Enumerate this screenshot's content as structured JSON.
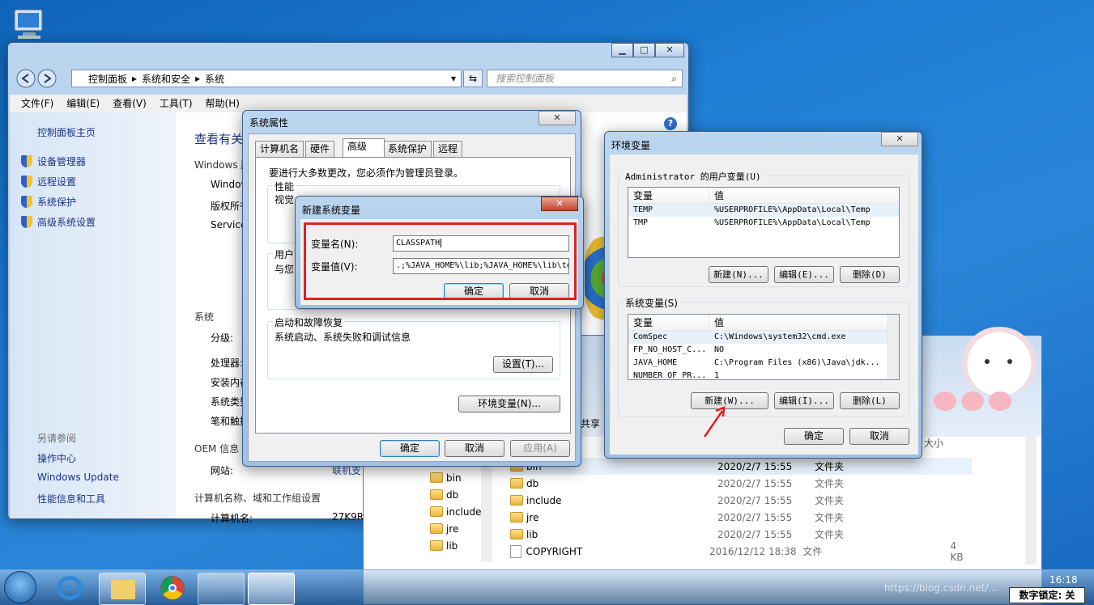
{
  "control_panel": {
    "address": [
      "控制面板",
      "系统和安全",
      "系统"
    ],
    "search_placeholder": "搜索控制面板",
    "menu": [
      "文件(F)",
      "编辑(E)",
      "查看(V)",
      "工具(T)",
      "帮助(H)"
    ],
    "sidebar": {
      "home": "控制面板主页",
      "items": [
        "设备管理器",
        "远程设置",
        "系统保护",
        "高级系统设置"
      ],
      "see_also_title": "另请参阅",
      "see_also": [
        "操作中心",
        "Windows Update",
        "性能信息和工具"
      ]
    },
    "main": {
      "title": "查看有关",
      "windows_edition": "Windows 版",
      "edition_lines": [
        "Windov",
        "版权所有",
        "Service"
      ],
      "system_heading": "系统",
      "system_rows": [
        "分级:",
        "处理器:",
        "安装内存",
        "系统类型",
        "笔和触摸"
      ],
      "oem_heading": "OEM 信息",
      "website_label": "网站:",
      "website_link": "联机支",
      "computer_heading": "计算机名称、域和工作组设置",
      "computer_name_label": "计算机名:",
      "computer_name_value": "27K9R"
    }
  },
  "system_properties": {
    "title": "系统属性",
    "tabs": [
      "计算机名",
      "硬件",
      "高级",
      "系统保护",
      "远程"
    ],
    "admin_note": "要进行大多数更改，您必须作为管理员登录。",
    "performance": {
      "label": "性能",
      "text": "视觉"
    },
    "user_profiles": {
      "label": "用户配",
      "text": "与您"
    },
    "startup": {
      "label": "启动和故障恢复",
      "text": "系统启动、系统失败和调试信息",
      "settings": "设置(T)..."
    },
    "env_button": "环境变量(N)...",
    "ok": "确定",
    "cancel": "取消",
    "apply": "应用(A)"
  },
  "new_var_dialog": {
    "title": "新建系统变量",
    "name_label": "变量名(N):",
    "name_value": "CLASSPATH",
    "value_label": "变量值(V):",
    "value_value": ".;%JAVA_HOME%\\lib;%JAVA_HOME%\\lib\\to",
    "ok": "确定",
    "cancel": "取消"
  },
  "env_vars": {
    "title": "环境变量",
    "user_group": "Administrator 的用户变量(U)",
    "columns": [
      "变量",
      "值"
    ],
    "user_rows": [
      {
        "name": "TEMP",
        "value": "%USERPROFILE%\\AppData\\Local\\Temp"
      },
      {
        "name": "TMP",
        "value": "%USERPROFILE%\\AppData\\Local\\Temp"
      }
    ],
    "user_buttons": [
      "新建(N)...",
      "编辑(E)...",
      "删除(D)"
    ],
    "system_group": "系统变量(S)",
    "system_rows": [
      {
        "name": "ComSpec",
        "value": "C:\\Windows\\system32\\cmd.exe"
      },
      {
        "name": "FP_NO_HOST_C...",
        "value": "NO"
      },
      {
        "name": "JAVA_HOME",
        "value": "C:\\Program Files (x86)\\Java\\jdk..."
      },
      {
        "name": "NUMBER_OF_PR...",
        "value": "1"
      }
    ],
    "system_buttons": [
      "新建(W)...",
      "编辑(I)...",
      "删除(L)"
    ],
    "ok": "确定",
    "cancel": "取消"
  },
  "explorer": {
    "share_label": "共享",
    "size_header": "大小",
    "tree": [
      "bin",
      "db",
      "include",
      "jre",
      "lib"
    ],
    "files": [
      {
        "name": "bin",
        "date": "2020/2/7 15:55",
        "type": "文件夹",
        "size": ""
      },
      {
        "name": "db",
        "date": "2020/2/7 15:55",
        "type": "文件夹",
        "size": ""
      },
      {
        "name": "include",
        "date": "2020/2/7 15:55",
        "type": "文件夹",
        "size": ""
      },
      {
        "name": "jre",
        "date": "2020/2/7 15:55",
        "type": "文件夹",
        "size": ""
      },
      {
        "name": "lib",
        "date": "2020/2/7 15:55",
        "type": "文件夹",
        "size": ""
      },
      {
        "name": "COPYRIGHT",
        "date": "2016/12/12 18:38",
        "type": "文件",
        "size": "4 KB"
      }
    ]
  },
  "taskbar": {
    "time": "16:18",
    "watermark": "https://blog.csdn.net/...",
    "ime_status": "数字锁定: 关"
  }
}
